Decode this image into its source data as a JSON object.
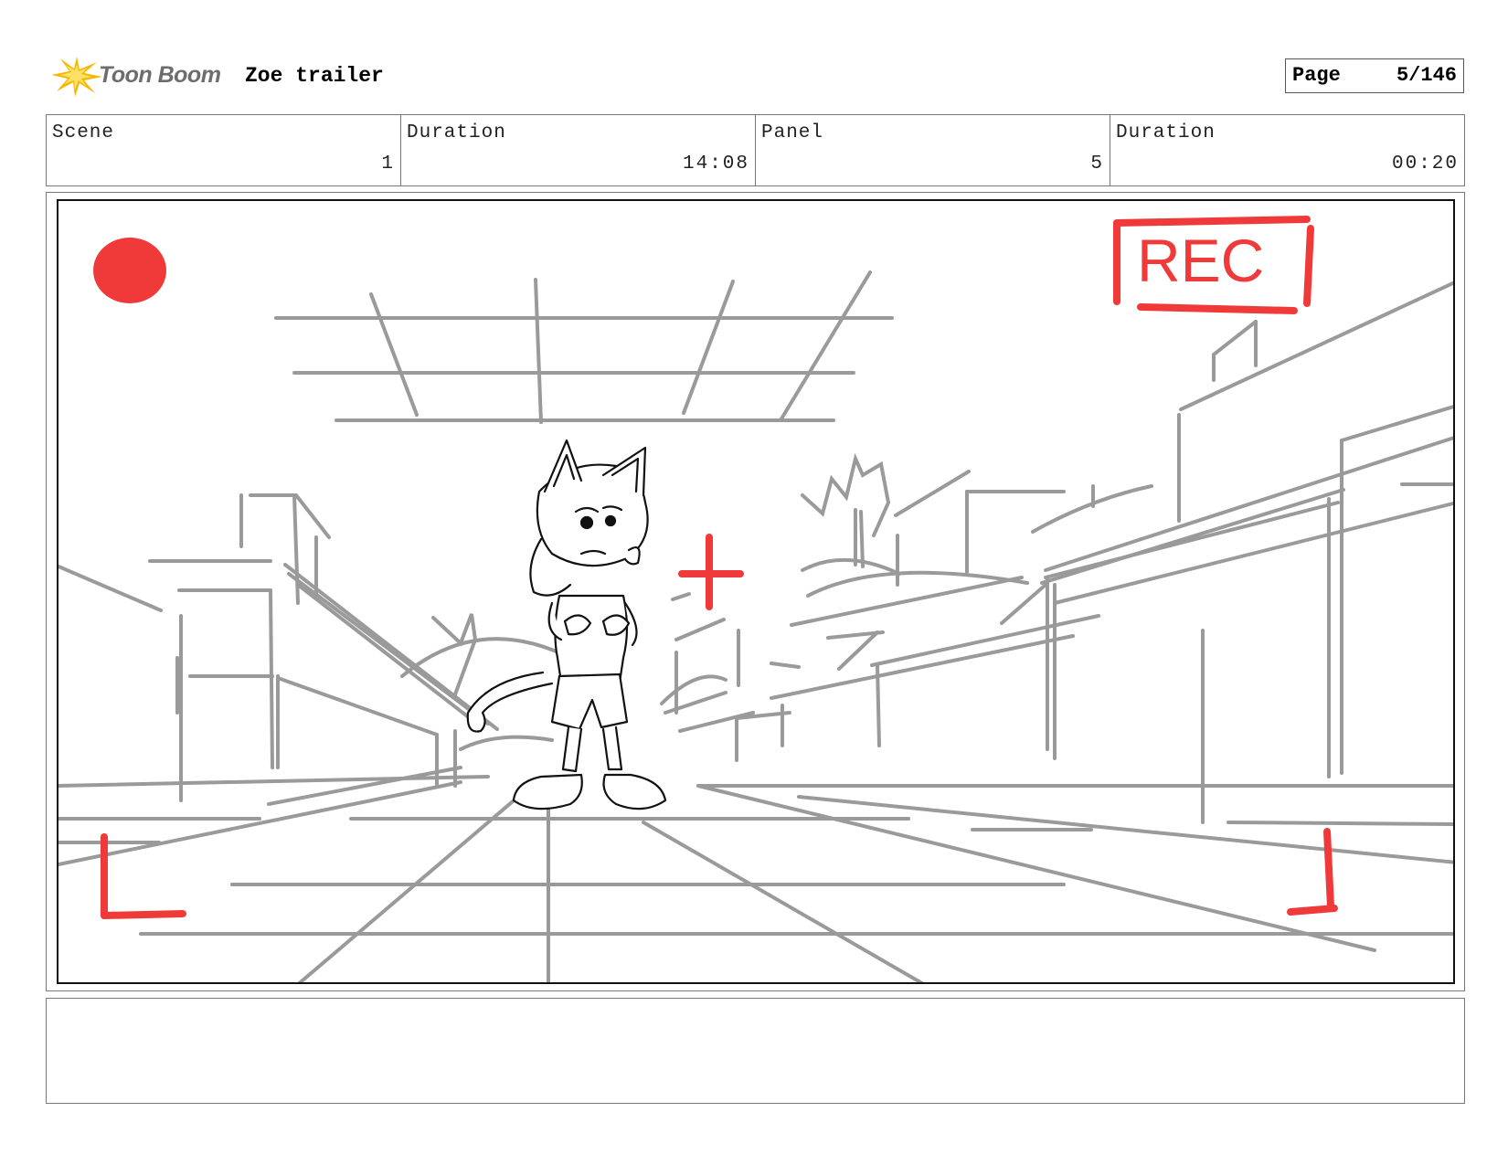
{
  "header": {
    "logo_text": "Toon Boom",
    "project_title": "Zoe trailer",
    "page_label": "Page",
    "page_value": "5/146"
  },
  "info": {
    "scene_label": "Scene",
    "scene_value": "1",
    "duration_label": "Duration",
    "duration_value": "14:08",
    "panel_label": "Panel",
    "panel_value": "5",
    "panel_duration_label": "Duration",
    "panel_duration_value": "00:20"
  },
  "panel": {
    "rec_text": "REC",
    "overlay_color": "#f03a3a",
    "sketch_color": "#9a9a9a"
  },
  "notes": {
    "text": ""
  }
}
